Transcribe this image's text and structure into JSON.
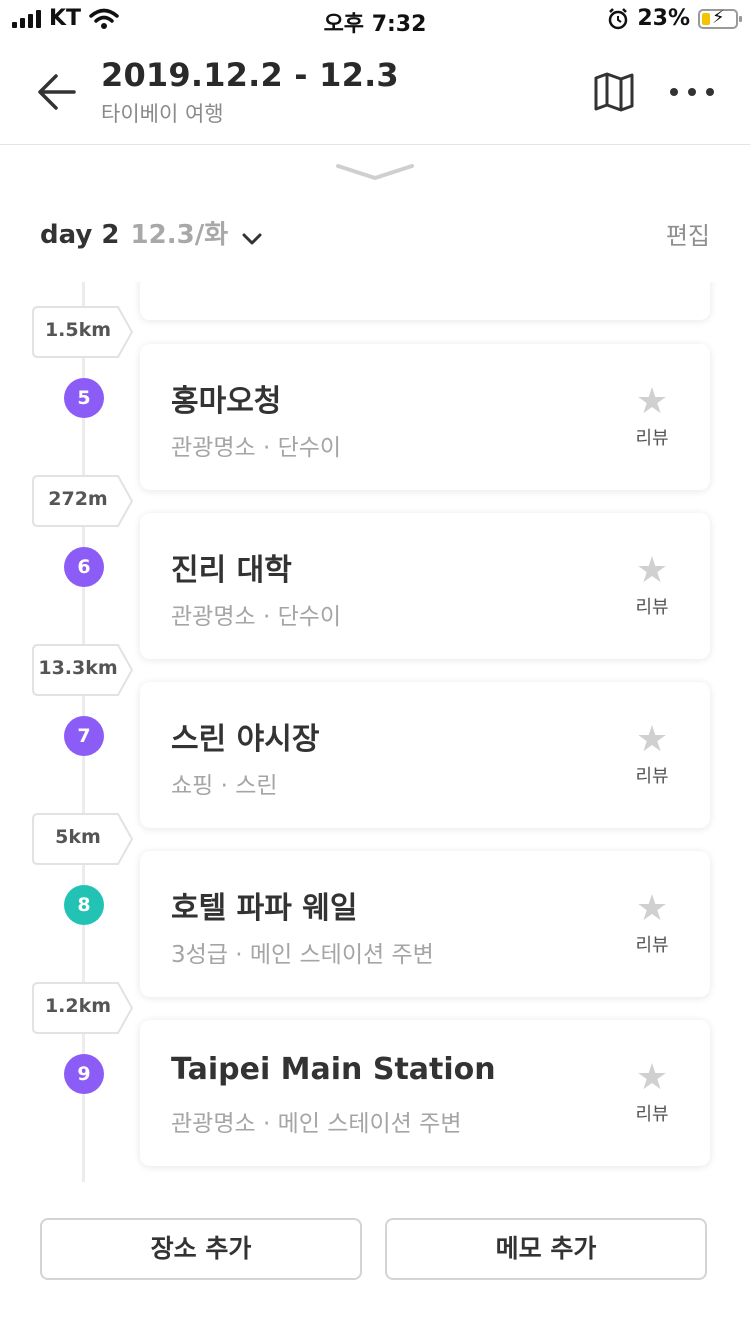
{
  "status_bar": {
    "carrier": "KT",
    "time": "오후 7:32",
    "battery": "23%",
    "battery_level": 0.23
  },
  "header": {
    "title": "2019.12.2 - 12.3",
    "subtitle": "타이베이 여행"
  },
  "day": {
    "label": "day 2",
    "date": "12.3/화",
    "edit": "편집"
  },
  "review_label": "리뷰",
  "places": [
    {
      "distance": "1.5km",
      "number": "5",
      "color": "#8b5cf6",
      "name": "홍마오청",
      "meta": "관광명소 · 단수이"
    },
    {
      "distance": "272m",
      "number": "6",
      "color": "#8b5cf6",
      "name": "진리 대학",
      "meta": "관광명소 · 단수이"
    },
    {
      "distance": "13.3km",
      "number": "7",
      "color": "#8b5cf6",
      "name": "스린 야시장",
      "meta": "쇼핑 · 스린"
    },
    {
      "distance": "5km",
      "number": "8",
      "color": "#22c3b4",
      "name": "호텔 파파 웨일",
      "meta": "3성급 · 메인 스테이션 주변"
    },
    {
      "distance": "1.2km",
      "number": "9",
      "color": "#8b5cf6",
      "name": "Taipei Main Station",
      "meta": "관광명소 · 메인 스테이션 주변"
    }
  ],
  "buttons": {
    "add_place": "장소 추가",
    "add_memo": "메모 추가"
  }
}
